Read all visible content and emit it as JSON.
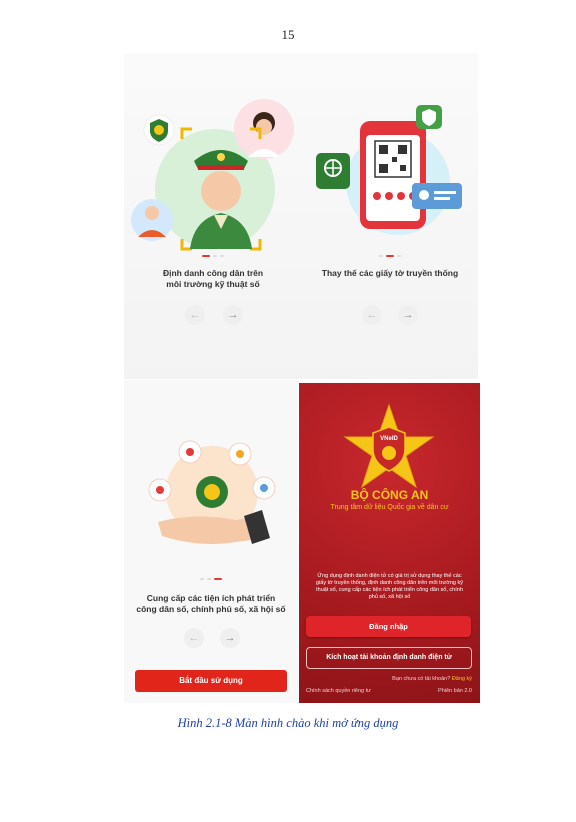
{
  "page": {
    "number": "15"
  },
  "screens": [
    {
      "caption_line1": "Định danh công dân trên",
      "caption_line2": "môi trường kỹ thuật số",
      "active_dot": 0
    },
    {
      "caption_line1": "Thay thế các giấy tờ truyền thống",
      "caption_line2": "",
      "active_dot": 1
    },
    {
      "caption_line1": "Cung cấp các tiện ích phát triển",
      "caption_line2": "công dân số, chính phủ số, xã hội số",
      "active_dot": 2,
      "start_button": "Bắt đầu sử dụng"
    }
  ],
  "nav": {
    "prev_arrow": "←",
    "next_arrow": "→"
  },
  "login_screen": {
    "emblem_text": "VNeID",
    "org_name": "BỘ CÔNG AN",
    "org_subtitle": "Trung tâm dữ liệu Quốc gia về dân cư",
    "description": "Ứng dụng định danh điện tử có giá trị sử dụng thay thế các giấy tờ truyền thống, định danh công dân trên môi trường kỹ thuật số, cung cấp các tiện ích phát triển công dân số, chính phủ số, xã hội số",
    "login_button": "Đăng nhập",
    "activate_button": "Kích hoạt tài khoản định danh điện tử",
    "no_account_text": "Bạn chưa có tài khoản?",
    "register_link": "Đăng ký",
    "privacy_link": "Chính sách quyền riêng tư",
    "version": "Phiên bản 2.0"
  },
  "figure": {
    "caption": "Hình 2.1-8 Màn hình chào khi mở ứng dụng"
  },
  "colors": {
    "brand_red": "#e0252a",
    "login_bg": "#a81b20",
    "gold": "#f5c518",
    "caption_blue": "#1d3fb3"
  }
}
